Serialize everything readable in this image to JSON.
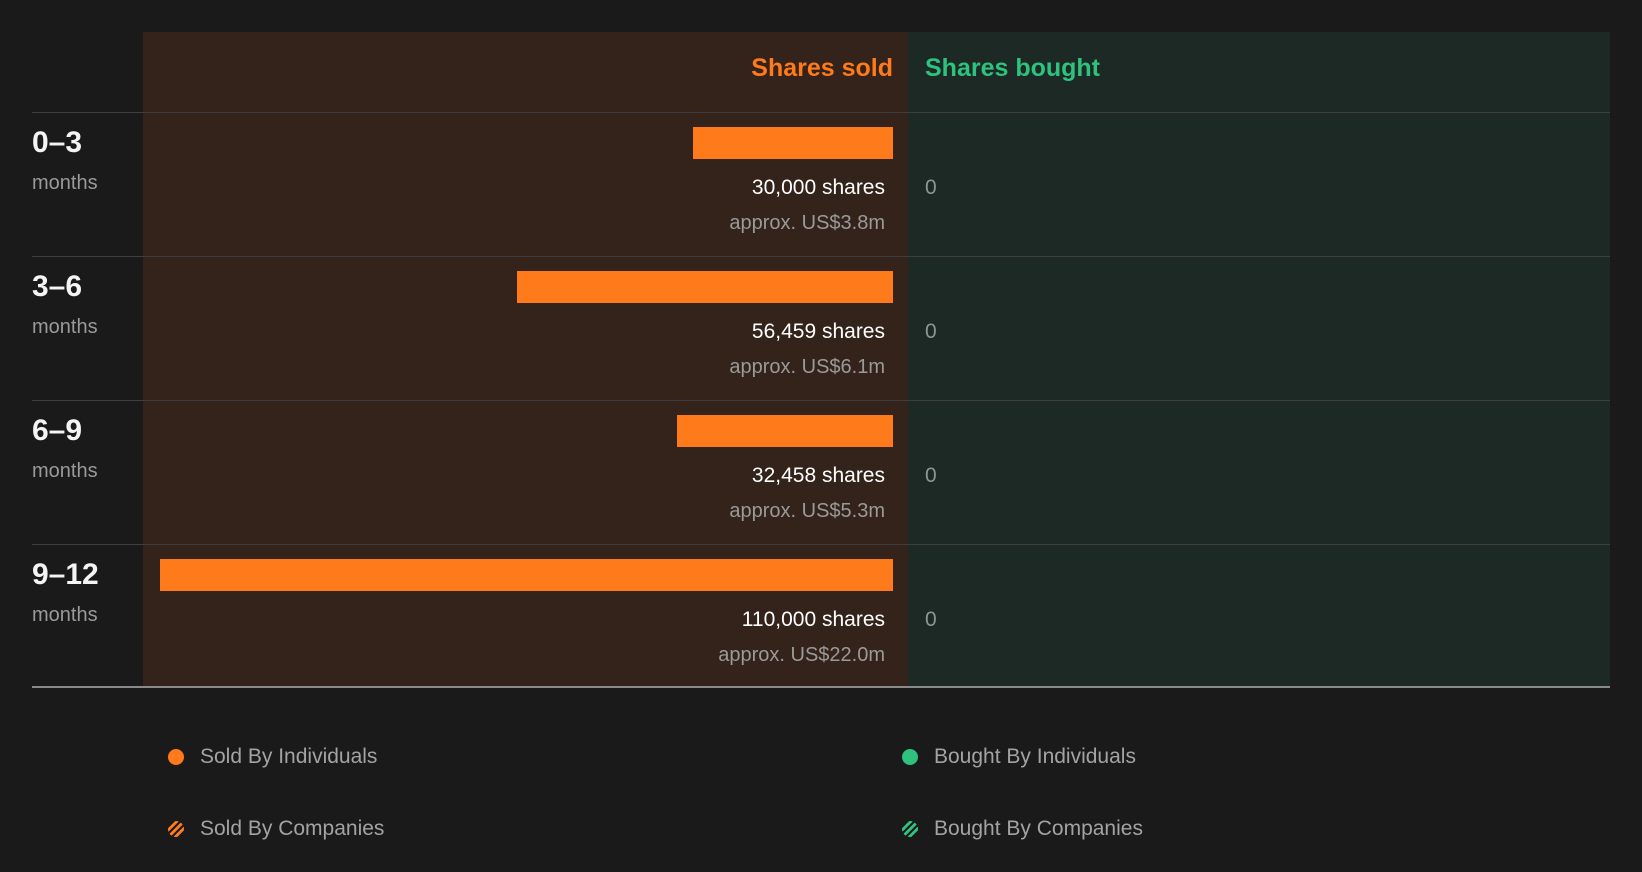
{
  "chart_data": {
    "type": "bar",
    "orientation": "horizontal",
    "columns": {
      "sold": "Shares sold",
      "bought": "Shares bought"
    },
    "categories": [
      {
        "range": "0–3",
        "unit": "months"
      },
      {
        "range": "3–6",
        "unit": "months"
      },
      {
        "range": "6–9",
        "unit": "months"
      },
      {
        "range": "9–12",
        "unit": "months"
      }
    ],
    "series": [
      {
        "name": "Shares sold",
        "values": [
          30000,
          56459,
          32458,
          110000
        ],
        "labels": [
          "30,000 shares",
          "56,459 shares",
          "32,458 shares",
          "110,000 shares"
        ],
        "value_labels": [
          "approx. US$3.8m",
          "approx. US$6.1m",
          "approx. US$5.3m",
          "approx. US$22.0m"
        ],
        "color": "#ff7a1a"
      },
      {
        "name": "Shares bought",
        "values": [
          0,
          0,
          0,
          0
        ],
        "labels": [
          "0",
          "0",
          "0",
          "0"
        ],
        "color": "#2ec27e"
      }
    ],
    "legend": [
      {
        "label": "Sold By Individuals",
        "color": "#ff7a1a",
        "pattern": "solid"
      },
      {
        "label": "Bought By Individuals",
        "color": "#2ec27e",
        "pattern": "solid"
      },
      {
        "label": "Sold By Companies",
        "color": "#ff7a1a",
        "pattern": "striped"
      },
      {
        "label": "Bought By Companies",
        "color": "#2ec27e",
        "pattern": "striped"
      }
    ],
    "legend_position": "bottom",
    "colors": {
      "background": "#1a1a1a",
      "sold_panel": "#33231b",
      "bought_panel": "#1d2924"
    }
  }
}
